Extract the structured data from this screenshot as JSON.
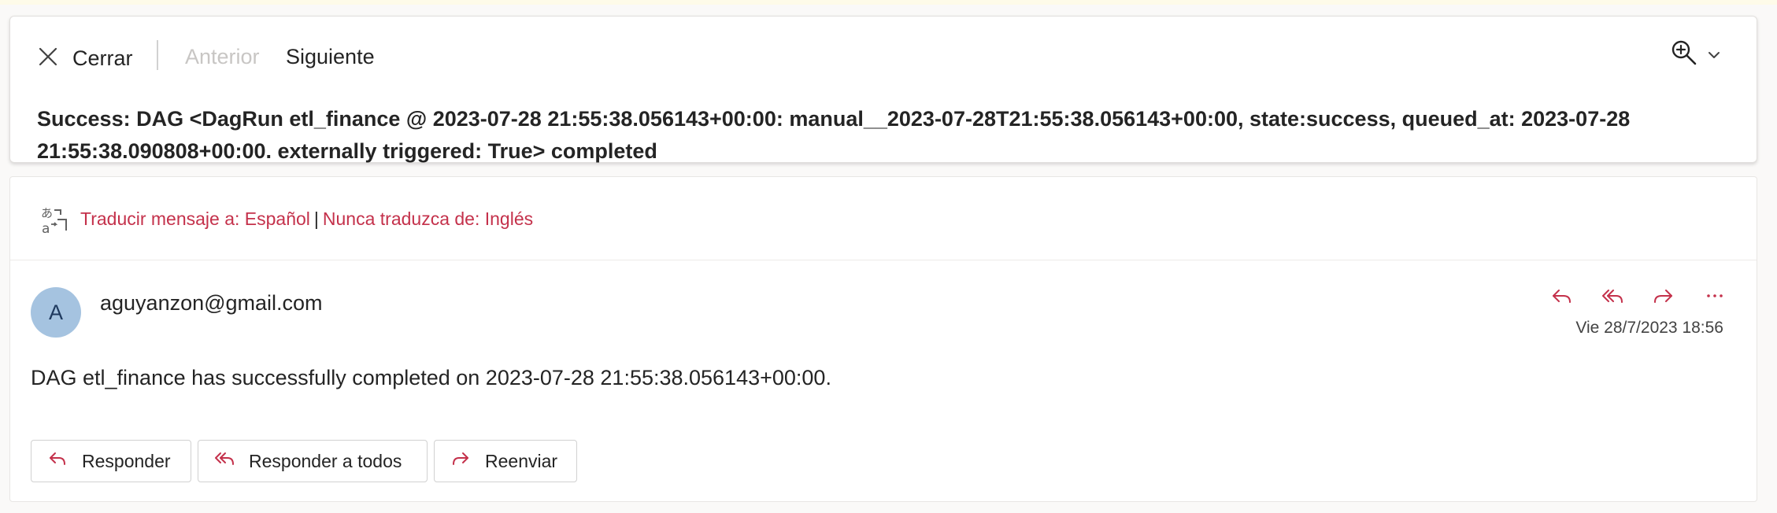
{
  "toolbar": {
    "close_label": "Cerrar",
    "prev_label": "Anterior",
    "next_label": "Siguiente",
    "icons": [
      "close-icon",
      "zoom-in-icon",
      "chevron-down-icon"
    ]
  },
  "subject": "Success: DAG <DagRun etl_finance @ 2023-07-28 21:55:38.056143+00:00: manual__2023-07-28T21:55:38.056143+00:00, state:success, queued_at: 2023-07-28 21:55:38.090808+00:00. externally triggered: True> completed",
  "translate": {
    "translate_link": "Traducir mensaje a: Español",
    "separator": "|",
    "never_link": "Nunca traduzca de: Inglés"
  },
  "message": {
    "avatar_initial": "A",
    "sender": "aguyanzon@gmail.com",
    "date": "Vie 28/7/2023 18:56",
    "body": "DAG etl_finance has successfully completed on 2023-07-28 21:55:38.056143+00:00.",
    "action_icons": [
      "reply-icon",
      "reply-all-icon",
      "forward-icon",
      "more-icon"
    ]
  },
  "buttons": {
    "reply": "Responder",
    "reply_all": "Responder a todos",
    "forward": "Reenviar"
  },
  "colors": {
    "accent": "#c4314b",
    "avatar_bg": "#a5c3e0",
    "text": "#242424",
    "disabled": "#c8c6c4"
  }
}
